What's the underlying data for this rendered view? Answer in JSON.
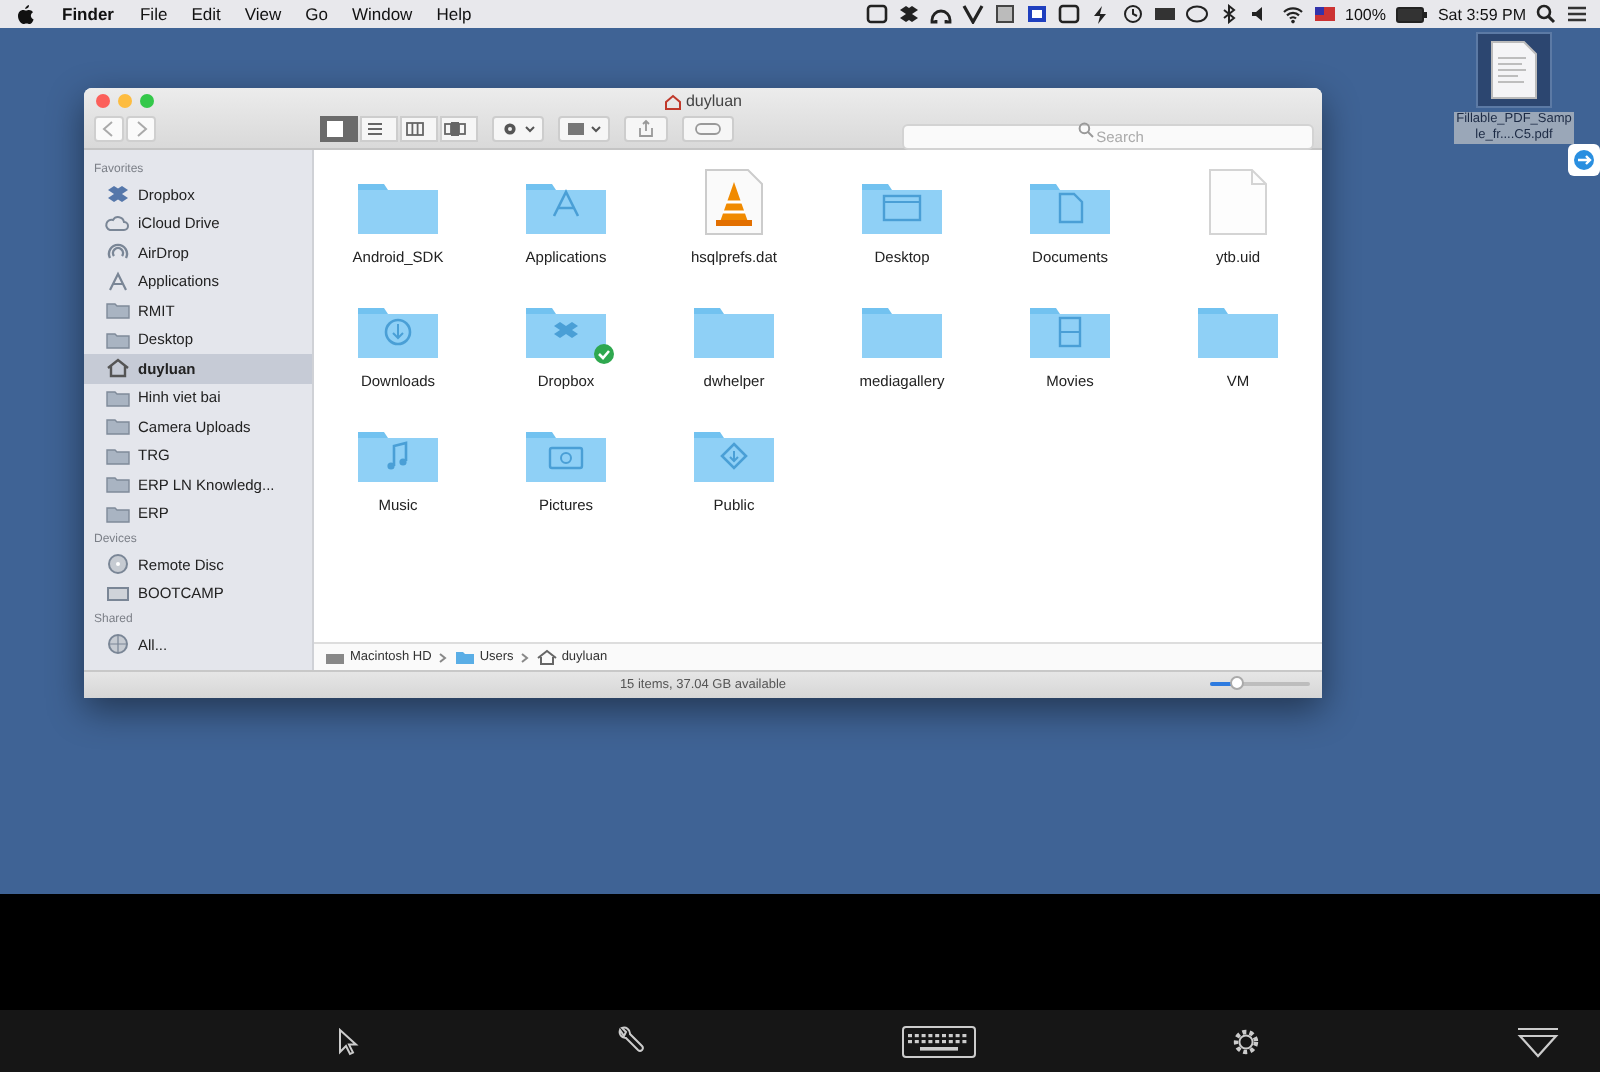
{
  "menu_bar": {
    "app": "Finder",
    "menus": [
      "File",
      "Edit",
      "View",
      "Go",
      "Window",
      "Help"
    ],
    "battery": "100%",
    "clock": "Sat 3:59 PM"
  },
  "desktop_file": {
    "name": "Fillable_PDF_Sample_fr....C5.pdf",
    "selected": true
  },
  "window": {
    "title": "duyluan",
    "view_modes": [
      {
        "kind": "icons",
        "selected": true
      },
      {
        "kind": "list",
        "selected": false
      },
      {
        "kind": "columns",
        "selected": false
      },
      {
        "kind": "coverflow",
        "selected": false
      }
    ],
    "search": {
      "placeholder": "Search"
    },
    "sidebar": [
      {
        "heading": "Favorites",
        "items": [
          {
            "label": "Dropbox",
            "kind": "dropbox",
            "selected": false
          },
          {
            "label": "iCloud Drive",
            "kind": "cloud",
            "selected": false
          },
          {
            "label": "AirDrop",
            "kind": "airdrop",
            "selected": false
          },
          {
            "label": "Applications",
            "kind": "applications",
            "selected": false
          },
          {
            "label": "RMIT",
            "kind": "folder",
            "selected": false
          },
          {
            "label": "Desktop",
            "kind": "folder",
            "selected": false
          },
          {
            "label": "duyluan",
            "kind": "home",
            "selected": true
          },
          {
            "label": "Hinh viet bai",
            "kind": "folder",
            "selected": false
          },
          {
            "label": "Camera Uploads",
            "kind": "folder",
            "selected": false
          },
          {
            "label": "TRG",
            "kind": "folder",
            "selected": false
          },
          {
            "label": "ERP LN Knowledg...",
            "kind": "folder",
            "selected": false
          },
          {
            "label": "ERP",
            "kind": "folder",
            "selected": false
          }
        ]
      },
      {
        "heading": "Devices",
        "items": [
          {
            "label": "Remote Disc",
            "kind": "disc",
            "selected": false
          },
          {
            "label": "BOOTCAMP",
            "kind": "drive",
            "selected": false
          }
        ]
      },
      {
        "heading": "Shared",
        "items": [
          {
            "label": "All...",
            "kind": "network",
            "selected": false
          }
        ]
      }
    ],
    "files": [
      {
        "name": "Android_SDK",
        "kind": "folder",
        "synced": false
      },
      {
        "name": "Applications",
        "kind": "applications",
        "synced": false
      },
      {
        "name": "hsqlprefs.dat",
        "kind": "vlc",
        "synced": false
      },
      {
        "name": "Desktop",
        "kind": "desktop",
        "synced": false
      },
      {
        "name": "Documents",
        "kind": "documents",
        "synced": false
      },
      {
        "name": "ytb.uid",
        "kind": "document",
        "synced": false
      },
      {
        "name": "Downloads",
        "kind": "downloads",
        "synced": false
      },
      {
        "name": "Dropbox",
        "kind": "dropbox",
        "synced": true
      },
      {
        "name": "dwhelper",
        "kind": "folder",
        "synced": false
      },
      {
        "name": "mediagallery",
        "kind": "folder",
        "synced": false
      },
      {
        "name": "Movies",
        "kind": "movies",
        "synced": false
      },
      {
        "name": "VM",
        "kind": "folder",
        "synced": false
      },
      {
        "name": "Music",
        "kind": "music",
        "synced": false
      },
      {
        "name": "Pictures",
        "kind": "pictures",
        "synced": false
      },
      {
        "name": "Public",
        "kind": "public",
        "synced": false
      }
    ],
    "path": [
      {
        "label": "Macintosh HD",
        "kind": "drive"
      },
      {
        "label": "Users",
        "kind": "folder"
      },
      {
        "label": "duyluan",
        "kind": "home"
      }
    ],
    "status": "15 items, 37.04 GB available",
    "icon_size": {
      "level": 0.25
    }
  }
}
